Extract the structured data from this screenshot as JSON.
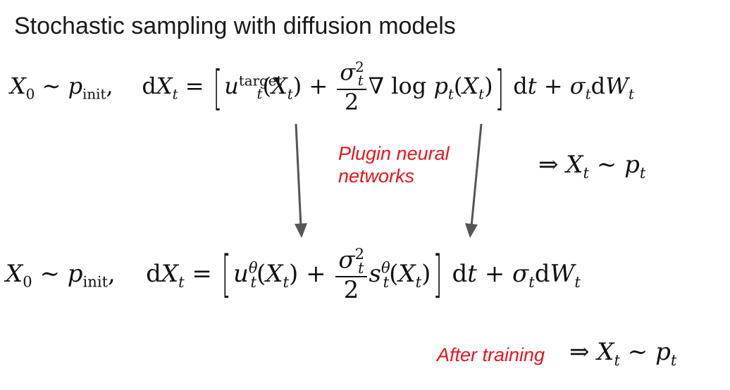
{
  "title": "Stochastic sampling with diffusion models",
  "labels": {
    "plugin_line1": "Plugin neural",
    "plugin_line2": "networks",
    "after_training": "After training"
  },
  "equations": {
    "eq1": "X_0 ~ p_init, dX_t = [u_t^target(X_t) + σ_t^2/2 ∇ log p_t(X_t)] dt + σ_t dW_t",
    "result1": "⇒ X_t ~ p_t",
    "eq2": "X_0 ~ p_init, dX_t = [u_t^θ(X_t) + σ_t^2/2 s_t^θ(X_t)] dt + σ_t dW_t",
    "result2": "⇒ X_t ~ p_t"
  },
  "colors": {
    "label": "#e8141c",
    "arrow": "#555555"
  }
}
